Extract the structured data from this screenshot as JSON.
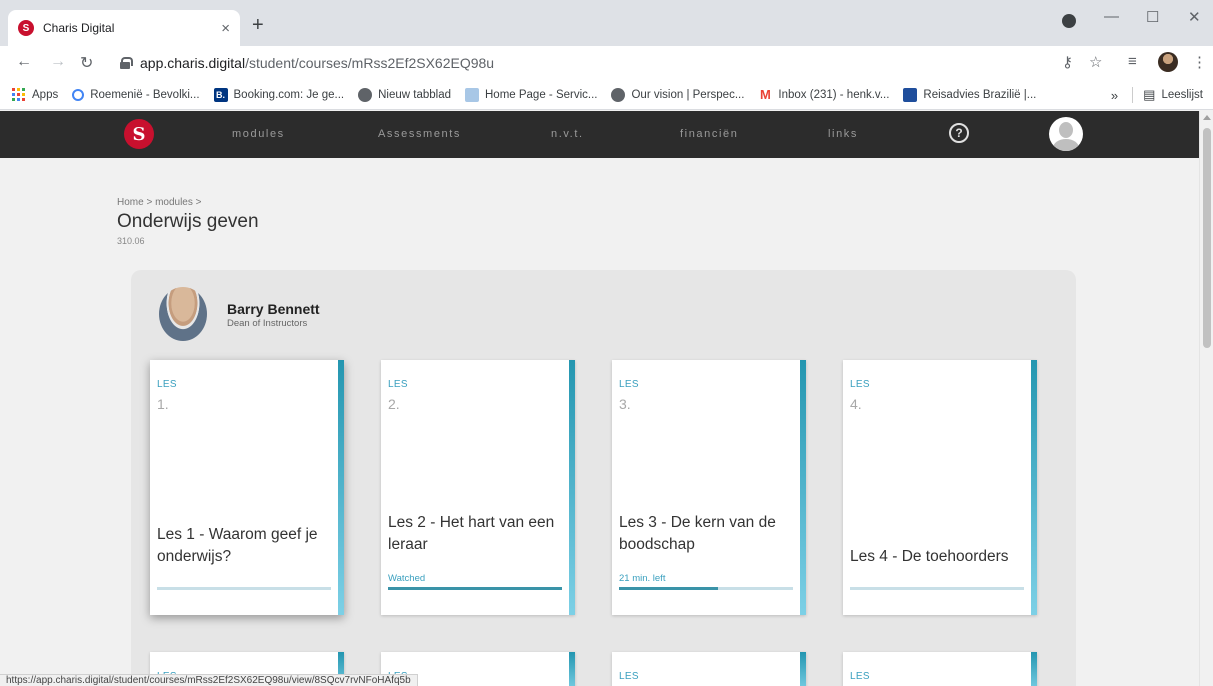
{
  "browser": {
    "tab_title": "Charis Digital",
    "tab_close": "×",
    "new_tab": "+",
    "url_host": "app.charis.digital",
    "url_path": "/student/courses/mRss2Ef2SX62EQ98u",
    "status_url": "https://app.charis.digital/student/courses/mRss2Ef2SX62EQ98u/view/8SQcv7rvNFoHAfq5b",
    "window_minimize": "—",
    "window_maximize": "☐",
    "window_close": "✕",
    "bookmarks": [
      {
        "label": "Apps",
        "icon": "apps-grid-icon"
      },
      {
        "label": "Roemenië - Bevolki...",
        "icon": "globe-icon"
      },
      {
        "label": "Booking.com: Je ge...",
        "icon": "booking-icon"
      },
      {
        "label": "Nieuw tabblad",
        "icon": "globe-icon"
      },
      {
        "label": "Home Page - Servic...",
        "icon": "page-icon"
      },
      {
        "label": "Our vision | Perspec...",
        "icon": "globe-icon"
      },
      {
        "label": "Inbox (231) - henk.v...",
        "icon": "gmail-icon"
      },
      {
        "label": "Reisadvies Brazilië |...",
        "icon": "flag-icon"
      }
    ],
    "bookmarks_more": "»",
    "reading_list": "Leeslijst"
  },
  "nav": {
    "links": [
      "modules",
      "Assessments",
      "n.v.t.",
      "financiën",
      "links"
    ],
    "help": "?"
  },
  "page": {
    "breadcrumb": "Home > modules >",
    "title": "Onderwijs geven",
    "code": "310.06"
  },
  "instructor": {
    "name": "Barry Bennett",
    "role": "Dean of Instructors"
  },
  "lessons": [
    {
      "label": "LES",
      "number": "1.",
      "title": "Les 1 - Waarom geef je onderwijs?",
      "status": "",
      "progress": 0
    },
    {
      "label": "LES",
      "number": "2.",
      "title": "Les 2 - Het hart van een leraar",
      "status": "Watched",
      "progress": 1.0
    },
    {
      "label": "LES",
      "number": "3.",
      "title": "Les 3 - De kern van de boodschap",
      "status": "21 min. left",
      "progress": 0.57
    },
    {
      "label": "LES",
      "number": "4.",
      "title": "Les 4 - De toehoorders",
      "status": "",
      "progress": 0
    }
  ],
  "lower_row_labels": [
    "LES",
    "LES",
    "LES",
    "LES"
  ],
  "colors": {
    "nav_bg": "#2c2c2c",
    "accent": "#2496b0",
    "brand_red": "#c8102e"
  }
}
